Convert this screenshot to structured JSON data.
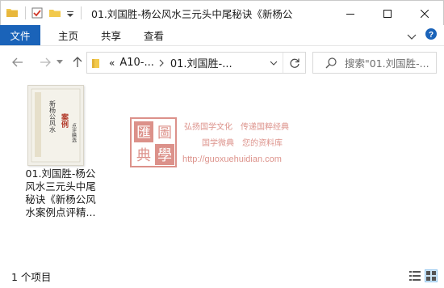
{
  "window": {
    "title": "01.刘国胜-杨公风水三元头中尾秘诀《新杨公风水..."
  },
  "ribbon": {
    "file_tab": "文件",
    "tabs": [
      "主页",
      "共享",
      "查看"
    ]
  },
  "address": {
    "overflow": "«",
    "crumbs": [
      "A10-...",
      "01.刘国胜-..."
    ]
  },
  "search": {
    "placeholder": "搜索\"01.刘国胜-..."
  },
  "file": {
    "name_lines": [
      "01.刘国胜-杨公",
      "风水三元头中尾",
      "秘诀《新杨公风",
      "水案例点评精..."
    ],
    "cover_text": [
      "新杨公风水",
      "案例",
      "点评精选"
    ]
  },
  "watermark": {
    "seal_chars": [
      "匯",
      "圖",
      "典",
      "學"
    ],
    "line1": "弘扬国学文化　传递国粹经典",
    "line2": "国学微典　您的资料库",
    "line3": "http://guoxuehuidian.com"
  },
  "status": {
    "item_count": "1 个项目"
  },
  "colors": {
    "file_tab": "#1a63b9",
    "seal": "#c0392b"
  }
}
